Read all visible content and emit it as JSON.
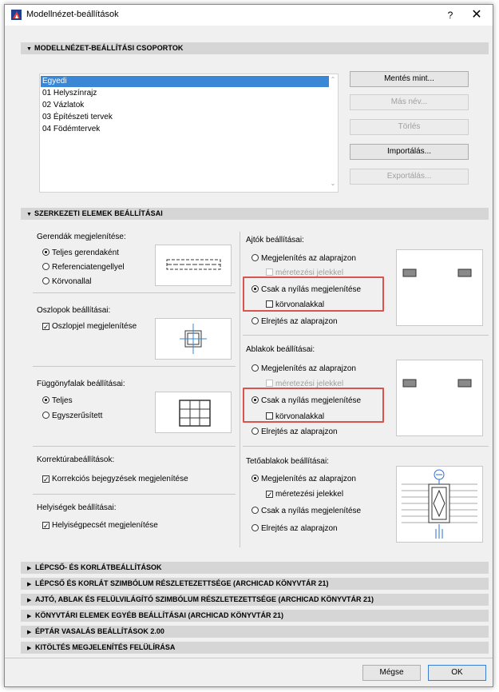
{
  "window": {
    "title": "Modellnézet-beállítások",
    "help": "?",
    "close": "✕"
  },
  "sections": {
    "groups_header": "MODELLNÉZET-BEÁLLÍTÁSI CSOPORTOK",
    "structure_header": "SZERKEZETI ELEMEK BEÁLLÍTÁSAI"
  },
  "groups_list": [
    "Egyedi",
    "01 Helyszínrajz",
    "02 Vázlatok",
    "03 Építészeti tervek",
    "04 Födémtervek"
  ],
  "group_buttons": {
    "save_as": "Mentés mint...",
    "rename": "Más név...",
    "delete": "Törlés",
    "import": "Importálás...",
    "export": "Exportálás..."
  },
  "beams": {
    "label": "Gerendák megjelenítése:",
    "options": [
      "Teljes gerendaként",
      "Referenciatengellyel",
      "Körvonallal"
    ],
    "selected": 0
  },
  "columns": {
    "label": "Oszlopok beállításai:",
    "check": "Oszlopjel megjelenítése"
  },
  "curtain": {
    "label": "Függönyfalak beállításai:",
    "options": [
      "Teljes",
      "Egyszerűsített"
    ],
    "selected": 0
  },
  "correction": {
    "label": "Korrektúrabeállítások:",
    "check": "Korrekciós bejegyzések megjelenítése"
  },
  "zones": {
    "label": "Helyiségek beállításai:",
    "check": "Helyiségpecsét megjelenítése"
  },
  "doors": {
    "label": "Ajtók beállításai:",
    "opt1": "Megjelenítés az alaprajzon",
    "sub1": "méretezési jelekkel",
    "opt2": "Csak a nyílás megjelenítése",
    "sub2": "körvonalakkal",
    "opt3": "Elrejtés az alaprajzon"
  },
  "windows": {
    "label": "Ablakok beállításai:",
    "opt1": "Megjelenítés az alaprajzon",
    "sub1": "méretezési jelekkel",
    "opt2": "Csak a nyílás megjelenítése",
    "sub2": "körvonalakkal",
    "opt3": "Elrejtés az alaprajzon"
  },
  "skylights": {
    "label": "Tetőablakok beállításai:",
    "opt1": "Megjelenítés az alaprajzon",
    "sub1": "méretezési jelekkel",
    "opt2": "Csak a nyílás megjelenítése",
    "opt3": "Elrejtés az alaprajzon"
  },
  "collapsed_sections": [
    "LÉPCSŐ- ÉS KORLÁTBEÁLLÍTÁSOK",
    "LÉPCSŐ ÉS KORLÁT SZIMBÓLUM RÉSZLETEZETTSÉGE (ARCHICAD KÖNYVTÁR 21)",
    "AJTÓ, ABLAK ÉS FELÜLVILÁGÍTÓ SZIMBÓLUM RÉSZLETEZETTSÉGE (ARCHICAD KÖNYVTÁR 21)",
    "KÖNYVTÁRI ELEMEK EGYÉB BEÁLLÍTÁSAI (ARCHICAD KÖNYVTÁR 21)",
    "ÉPTÁR VASALÁS BEÁLLÍTÁSOK 2.00",
    "KITÖLTÉS MEGJELENÍTÉS FELÜLÍRÁSA"
  ],
  "footer": {
    "cancel": "Mégse",
    "ok": "OK"
  },
  "colors": {
    "selection": "#3a87d6",
    "highlight": "#d9534f",
    "accent_blue": "#2a6fd6"
  }
}
